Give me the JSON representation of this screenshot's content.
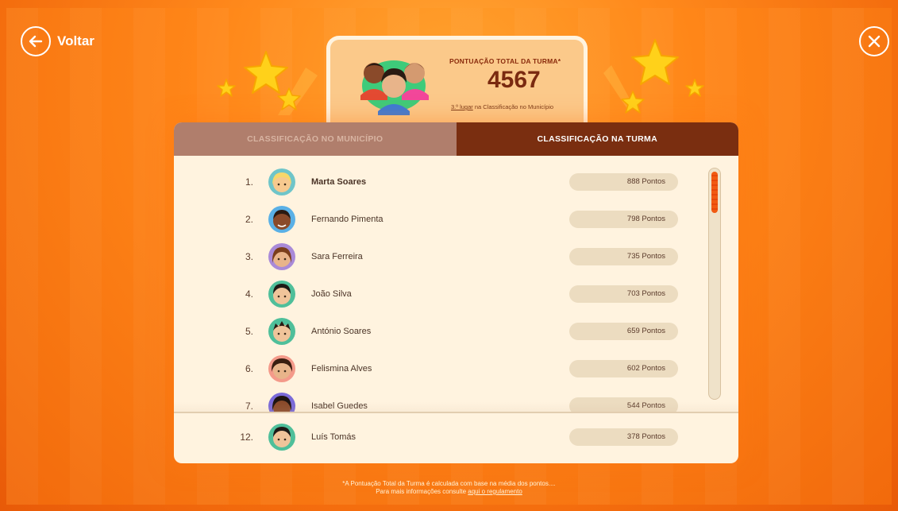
{
  "nav": {
    "back_label": "Voltar"
  },
  "score": {
    "title": "PONTUAÇÃO TOTAL DA TURMA*",
    "value": "4567",
    "rank_link": "3.º lugar",
    "rank_suffix": " na Classificação no Município"
  },
  "tabs": [
    {
      "label": "CLASSIFICAÇÃO NO MUNICÍPIO",
      "active": false
    },
    {
      "label": "CLASSIFICAÇÃO NA TURMA",
      "active": true
    }
  ],
  "ranking": [
    {
      "rank": "1.",
      "name": "Marta Soares",
      "points": "888 Pontos",
      "avatar": "girl-blonde-icon"
    },
    {
      "rank": "2.",
      "name": "Fernando Pimenta",
      "points": "798 Pontos",
      "avatar": "boy-dark-icon"
    },
    {
      "rank": "3.",
      "name": "Sara Ferreira",
      "points": "735 Pontos",
      "avatar": "girl-brown-icon"
    },
    {
      "rank": "4.",
      "name": "João Silva",
      "points": "703 Pontos",
      "avatar": "boy-curly-icon"
    },
    {
      "rank": "5.",
      "name": "António Soares",
      "points": "659 Pontos",
      "avatar": "boy-spiky-icon"
    },
    {
      "rank": "6.",
      "name": "Felismina Alves",
      "points": "602 Pontos",
      "avatar": "girl-curly-icon"
    },
    {
      "rank": "7.",
      "name": "Isabel Guedes",
      "points": "544 Pontos",
      "avatar": "girl-dark-icon"
    }
  ],
  "current_user": {
    "rank": "12.",
    "name": "Luís Tomás",
    "points": "378 Pontos",
    "avatar": "boy-curly-icon"
  },
  "footnote": {
    "line1": "*A Pontuação Total da Turma é calculada com base na média dos pontos....",
    "line2_prefix": "Para mais informações consulte ",
    "line2_link": "aqui o regulamento"
  },
  "colors": {
    "background": "#f58214",
    "tab_active": "#7a2e10",
    "tab_inactive": "#b07e6c",
    "panel": "#fff3df",
    "score_text": "#7a2a10"
  }
}
